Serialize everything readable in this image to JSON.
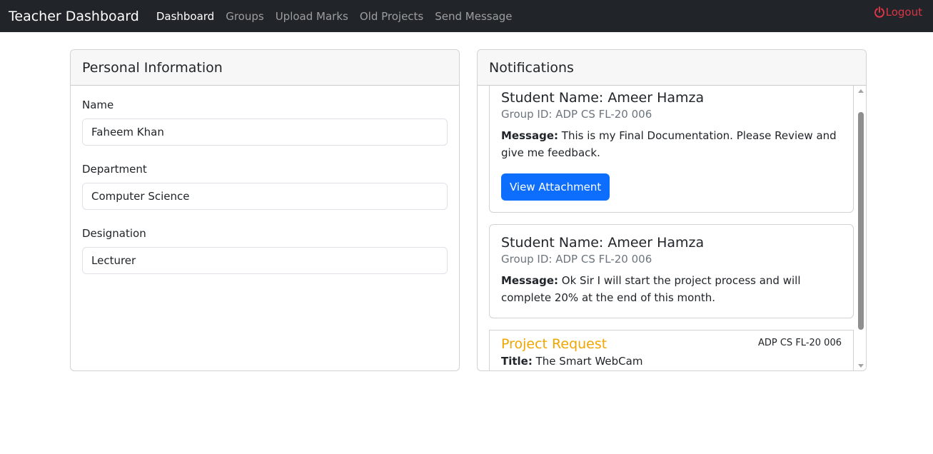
{
  "navbar": {
    "brand": "Teacher Dashboard",
    "links": [
      "Dashboard",
      "Groups",
      "Upload Marks",
      "Old Projects",
      "Send Message"
    ],
    "active": "Dashboard",
    "logout_label": "Logout",
    "logout_color": "#dc3545"
  },
  "personal": {
    "header": "Personal Information",
    "fields": [
      {
        "label": "Name",
        "value": "Faheem Khan"
      },
      {
        "label": "Department",
        "value": "Computer Science"
      },
      {
        "label": "Designation",
        "value": "Lecturer"
      }
    ]
  },
  "notifications": {
    "header": "Notifications",
    "items": [
      {
        "student": "Student Name: Ameer Hamza",
        "group": "Group ID: ADP CS FL-20 006",
        "message_label": "Message:",
        "message": "This is my Final Documentation. Please Review and give me feedback.",
        "button": "View Attachment"
      },
      {
        "student": "Student Name: Ameer Hamza",
        "group": "Group ID: ADP CS FL-20 006",
        "message_label": "Message:",
        "message": "Ok Sir I will start the project process and will complete 20% at the end of this month."
      }
    ],
    "request": {
      "title": "Project Request",
      "group": "ADP CS FL-20 006",
      "title_label": "Title:",
      "title_value": "The Smart WebCam",
      "accent": "#f0a500"
    }
  },
  "colors": {
    "navbar_bg": "#212529",
    "primary": "#0d6efd"
  }
}
